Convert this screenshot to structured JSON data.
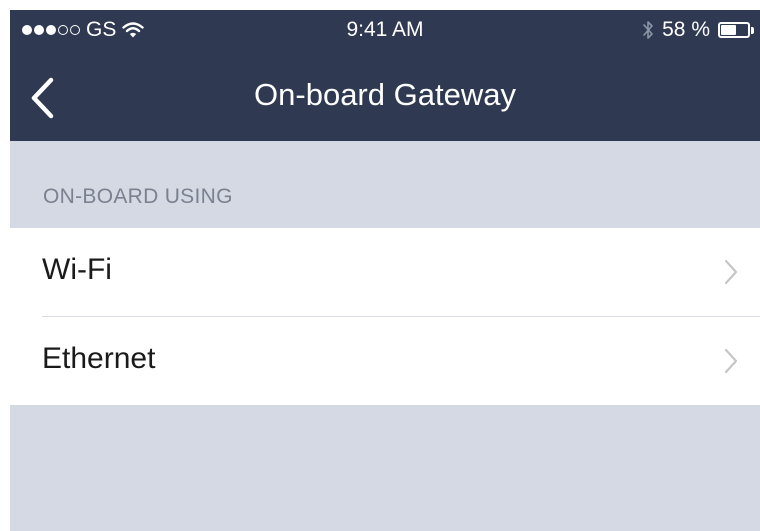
{
  "status_bar": {
    "signal_filled": 3,
    "signal_total": 5,
    "carrier": "GS",
    "wifi_icon": "wifi-icon",
    "time": "9:41 AM",
    "bluetooth_icon": "bluetooth-icon",
    "battery_label": "58 %",
    "battery_level": 0.58
  },
  "nav": {
    "back_icon": "chevron-left-icon",
    "title": "On-board Gateway"
  },
  "section": {
    "header": "ON-BOARD USING",
    "items": [
      {
        "label": "Wi-Fi",
        "icon": "chevron-right-icon"
      },
      {
        "label": "Ethernet",
        "icon": "chevron-right-icon"
      }
    ]
  },
  "colors": {
    "nav_background": "#2f3a52",
    "page_background": "#d4d9e3",
    "row_background": "#ffffff",
    "section_header_text": "#7b8190",
    "chevron": "#c4c6cc"
  }
}
